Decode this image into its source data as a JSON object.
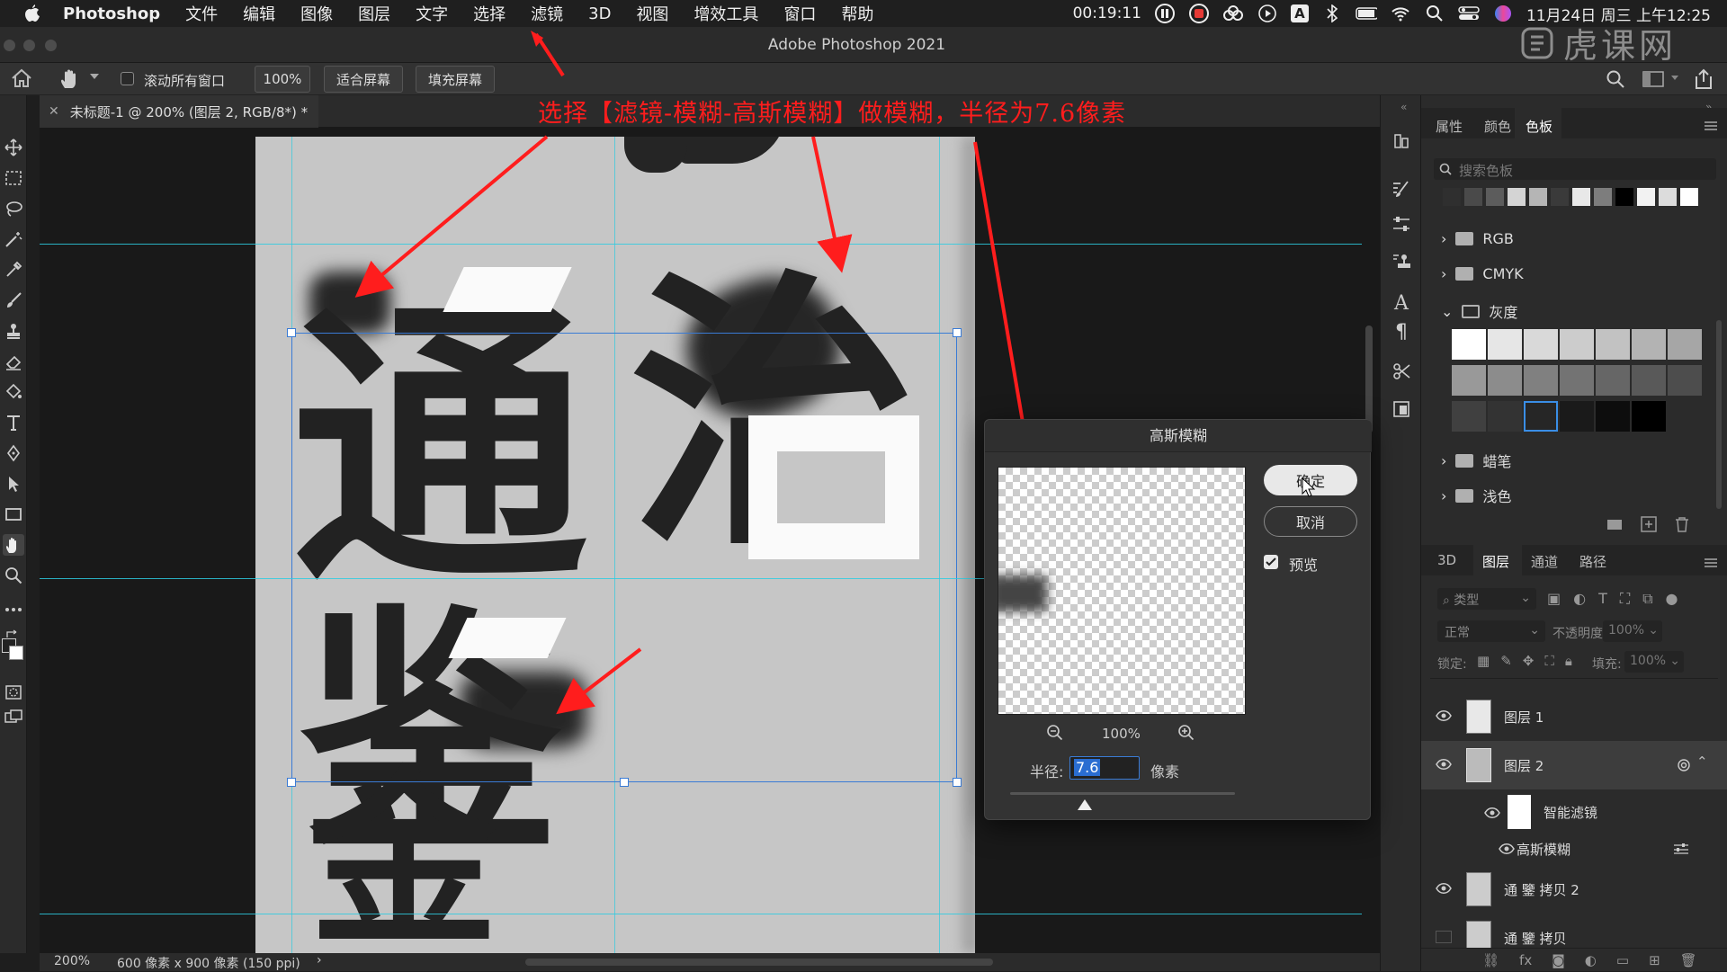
{
  "menubar": {
    "app_name": "Photoshop",
    "items": [
      "文件",
      "编辑",
      "图像",
      "图层",
      "文字",
      "选择",
      "滤镜",
      "3D",
      "视图",
      "增效工具",
      "窗口",
      "帮助"
    ],
    "clock": "00:19:11",
    "date_time": "11月24日 周三 上午12:25",
    "input_method": "A"
  },
  "window": {
    "title": "Adobe Photoshop 2021"
  },
  "watermark": {
    "text": "虎课网"
  },
  "options_bar": {
    "scroll_all_label": "滚动所有窗口",
    "zoom_button": "100%",
    "fit_screen": "适合屏幕",
    "fill_screen": "填充屏幕"
  },
  "document_tab": {
    "label": "未标题-1 @ 200% (图层 2, RGB/8*) *"
  },
  "annotation": {
    "text": "选择【滤镜-模糊-高斯模糊】做模糊，半径为7.6像素"
  },
  "canvas_glyphs": {
    "tong": "通",
    "zhi": "治",
    "jian": "鉴",
    "jin": "金"
  },
  "status_bar": {
    "zoom": "200%",
    "doc_info": "600 像素 x 900 像素 (150 ppi)"
  },
  "swatches_panel": {
    "tabs": [
      "属性",
      "颜色",
      "色板"
    ],
    "active_tab": "色板",
    "search_placeholder": "搜索色板",
    "groups": [
      {
        "name": "RGB",
        "expanded": false
      },
      {
        "name": "CMYK",
        "expanded": false
      },
      {
        "name": "灰度",
        "expanded": true
      },
      {
        "name": "蜡笔",
        "expanded": false
      },
      {
        "name": "浅色",
        "expanded": false
      }
    ],
    "recent_colors": [
      "#2f2f2f",
      "#4a4a4a",
      "#5c5c5c",
      "#d4d4d4",
      "#b5b5b5",
      "#3a3a3a",
      "#e8e8e8",
      "#7d7d7d",
      "#000000",
      "#f2f2f2",
      "#dcdcdc",
      "#ffffff"
    ],
    "gray_colors": [
      "#ffffff",
      "#e6e6e6",
      "#d9d9d9",
      "#cccccc",
      "#c2c2c2",
      "#b3b3b3",
      "#a6a6a6",
      "#999999",
      "#8c8c8c",
      "#808080",
      "#737373",
      "#666666",
      "#595959",
      "#4d4d4d",
      "#404040",
      "#333333",
      "#262626",
      "#1a1a1a",
      "#0d0d0d",
      "#000000"
    ]
  },
  "layers_panel": {
    "tabs": [
      "3D",
      "图层",
      "通道",
      "路径"
    ],
    "active_tab": "图层",
    "filter_kind": "类型",
    "blend_mode": "正常",
    "opacity_label": "不透明度:",
    "opacity_value": "100%",
    "lock_label": "锁定:",
    "fill_label": "填充:",
    "fill_value": "100%",
    "layers": [
      {
        "name": "图层 1"
      },
      {
        "name": "图层 2"
      },
      {
        "name": "智能滤镜"
      },
      {
        "name": "高斯模糊"
      },
      {
        "name": "通 鑒 拷贝 2"
      },
      {
        "name": "通 鑒 拷贝"
      }
    ]
  },
  "gaussian_blur_dialog": {
    "title": "高斯模糊",
    "ok_label": "确定",
    "cancel_label": "取消",
    "preview_label": "预览",
    "preview_checked": true,
    "zoom": "100%",
    "radius_label": "半径:",
    "radius_value": "7.6",
    "unit": "像素"
  }
}
